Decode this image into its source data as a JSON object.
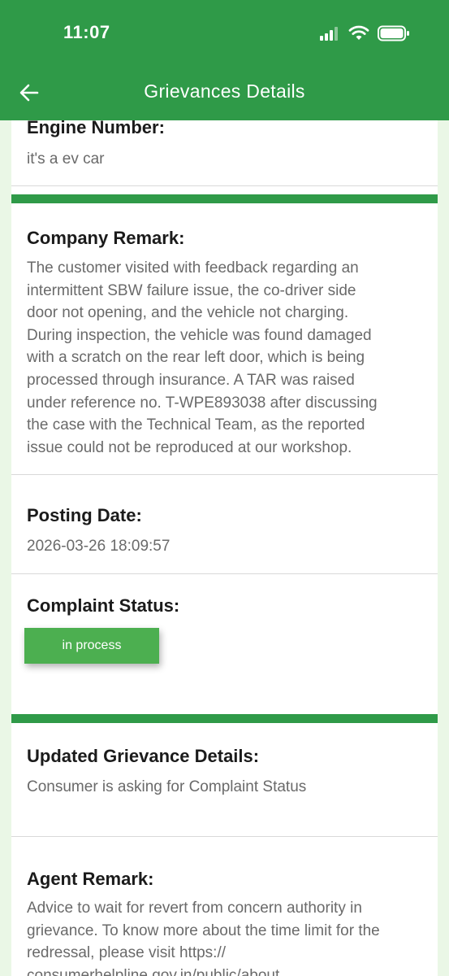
{
  "status_bar": {
    "time": "11:07"
  },
  "header": {
    "title": "Grievances Details"
  },
  "fields": {
    "engine_number": {
      "label": "Engine Number:",
      "value": "it's a ev car"
    },
    "company_remark": {
      "label": "Company Remark:",
      "lines": [
        "The customer visited with feedback regarding an",
        "intermittent SBW failure issue, the co-driver side",
        "door not opening, and the vehicle not charging.",
        "During inspection, the vehicle was found damaged",
        "with a scratch on the rear left door, which is being",
        "processed through insurance. A TAR was raised",
        "under reference no. T-WPE893038 after discussing",
        "the case with the Technical Team, as the reported",
        "issue could not be reproduced at our workshop."
      ]
    },
    "posting_date": {
      "label": "Posting Date:",
      "value": "2026-03-26 18:09:57"
    },
    "complaint_status": {
      "label": "Complaint Status:",
      "value": "in process"
    },
    "updated_grievance": {
      "label": "Updated Grievance Details:",
      "value": "Consumer is asking for Complaint Status"
    },
    "agent_remark": {
      "label": "Agent Remark:",
      "lines": [
        "Advice to wait for revert from concern authority in",
        "grievance. To know more about the time limit for the",
        "redressal, please visit https://",
        "consumerhelpline.gov.in/public/about"
      ]
    }
  },
  "colors": {
    "header_green": "#2f9a48",
    "badge_green": "#4caf50"
  }
}
